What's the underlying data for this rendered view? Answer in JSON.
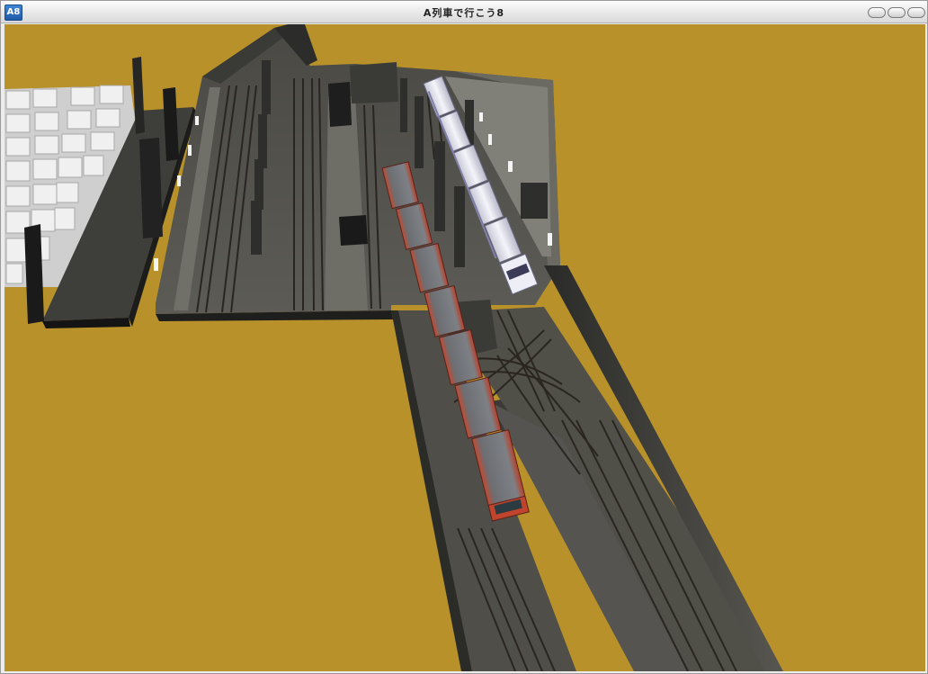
{
  "window": {
    "title": "A列車で行こう8",
    "icon_text": "A8",
    "controls": [
      "minimize",
      "maximize",
      "close"
    ]
  },
  "scene": {
    "ground_color": "#b8912a",
    "trains": [
      {
        "name": "red-commuter-train",
        "color": "#b9402c"
      },
      {
        "name": "white-express-train",
        "color": "#e8e8f0"
      }
    ]
  }
}
